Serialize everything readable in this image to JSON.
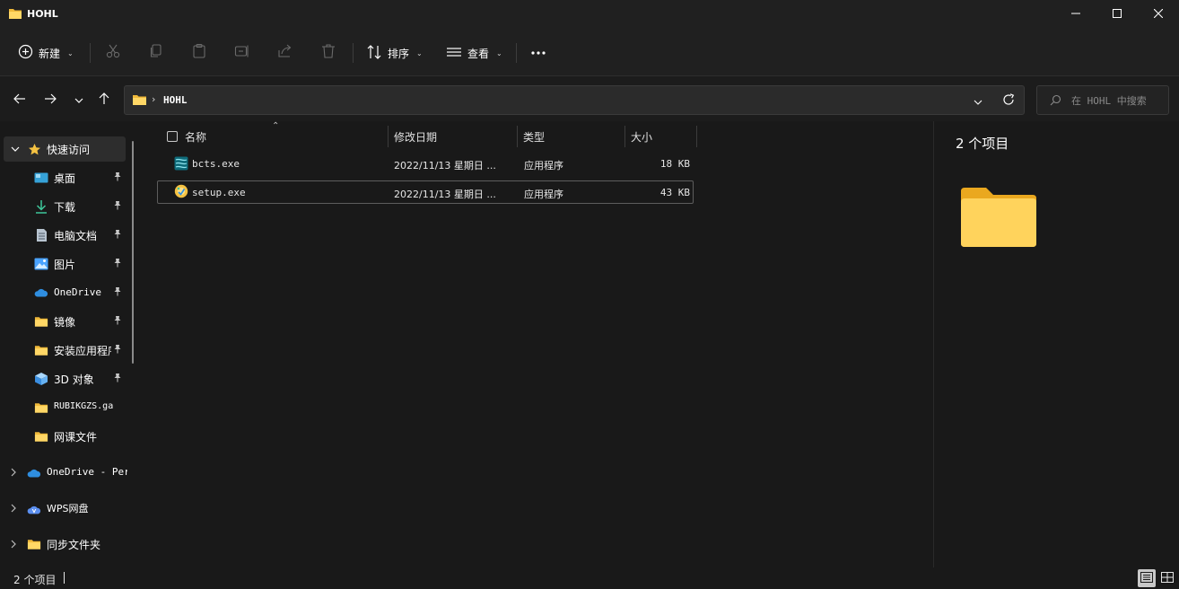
{
  "window": {
    "title": "HOHL"
  },
  "toolbar": {
    "new_label": "新建",
    "sort_label": "排序",
    "view_label": "查看"
  },
  "address": {
    "path": "HOHL"
  },
  "search": {
    "placeholder": "在 HOHL 中搜索"
  },
  "sidebar": {
    "quick_access": "快速访问",
    "items": [
      {
        "label": "桌面",
        "icon": "desktop-icon",
        "pinned": true
      },
      {
        "label": "下载",
        "icon": "download-icon",
        "pinned": true
      },
      {
        "label": "电脑文档",
        "icon": "document-icon",
        "pinned": true
      },
      {
        "label": "图片",
        "icon": "pictures-icon",
        "pinned": true
      },
      {
        "label": "OneDrive",
        "icon": "onedrive-icon",
        "pinned": true
      },
      {
        "label": "镜像",
        "icon": "folder-icon",
        "pinned": true
      },
      {
        "label": "安装应用程序",
        "icon": "folder-icon",
        "pinned": true
      },
      {
        "label": "3D 对象",
        "icon": "3d-objects-icon",
        "pinned": true
      },
      {
        "label": "RUBIKGZS.ga",
        "icon": "folder-icon",
        "pinned": false
      },
      {
        "label": "网课文件",
        "icon": "folder-icon",
        "pinned": false
      }
    ],
    "roots": [
      {
        "label": "OneDrive - Pers",
        "icon": "onedrive-icon"
      },
      {
        "label": "WPS网盘",
        "icon": "wps-cloud-icon"
      },
      {
        "label": "同步文件夹",
        "icon": "folder-icon"
      }
    ]
  },
  "filelist": {
    "columns": {
      "name": "名称",
      "date": "修改日期",
      "type": "类型",
      "size": "大小"
    },
    "rows": [
      {
        "name": "bcts.exe",
        "date": "2022/11/13 星期日 ...",
        "type": "应用程序",
        "size": "18 KB",
        "icon": "exe-app-icon"
      },
      {
        "name": "setup.exe",
        "date": "2022/11/13 星期日 ...",
        "type": "应用程序",
        "size": "43 KB",
        "icon": "setup-installer-icon"
      }
    ]
  },
  "details": {
    "count": "2 个项目"
  },
  "status": {
    "count": "2 个项目"
  },
  "colors": {
    "background": "#191919",
    "chrome": "#202020",
    "folder": "#f5c242",
    "accent_blue": "#4aa3ff"
  }
}
